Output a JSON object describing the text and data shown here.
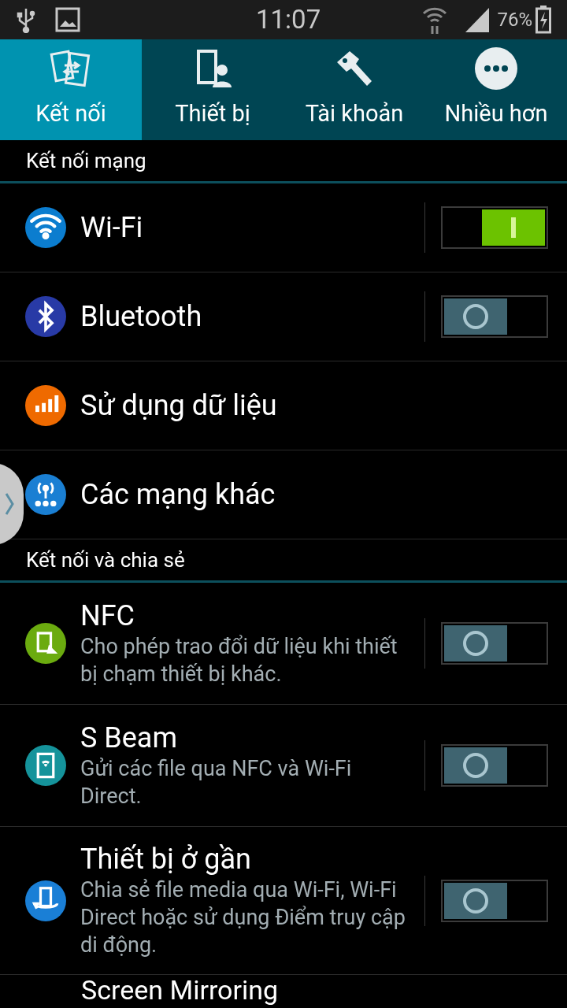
{
  "status_bar": {
    "time": "11:07",
    "battery": "76%"
  },
  "tabs": [
    {
      "label": "Kết nối",
      "selected": true
    },
    {
      "label": "Thiết bị",
      "selected": false
    },
    {
      "label": "Tài khoản",
      "selected": false
    },
    {
      "label": "Nhiều hơn",
      "selected": false
    }
  ],
  "sections": [
    {
      "title": "Kết nối mạng",
      "items": [
        {
          "title": "Wi-Fi",
          "color": "#0b7dcf",
          "kind": "toggle",
          "on": true
        },
        {
          "title": "Bluetooth",
          "color": "#283aa6",
          "kind": "toggle",
          "on": false
        },
        {
          "title": "Sử dụng dữ liệu",
          "color": "#ef6a00",
          "kind": "plain"
        },
        {
          "title": "Các mạng khác",
          "color": "#1a7fd3",
          "kind": "plain"
        }
      ]
    },
    {
      "title": "Kết nối và chia sẻ",
      "items": [
        {
          "title": "NFC",
          "subtitle": "Cho phép trao đổi dữ liệu khi thiết bị chạm thiết bị khác.",
          "color": "#6bab0f",
          "kind": "toggle",
          "on": false
        },
        {
          "title": "S Beam",
          "subtitle": "Gửi các file qua NFC và Wi-Fi Direct.",
          "color": "#15939b",
          "kind": "toggle",
          "on": false
        },
        {
          "title": "Thiết bị ở gần",
          "subtitle": "Chia sẻ file media qua Wi-Fi, Wi-Fi Direct hoặc sử dụng Điểm truy cập di động.",
          "color": "#1a7fd6",
          "kind": "toggle",
          "on": false
        },
        {
          "title": "Screen Mirroring",
          "kind": "partial"
        }
      ]
    }
  ]
}
